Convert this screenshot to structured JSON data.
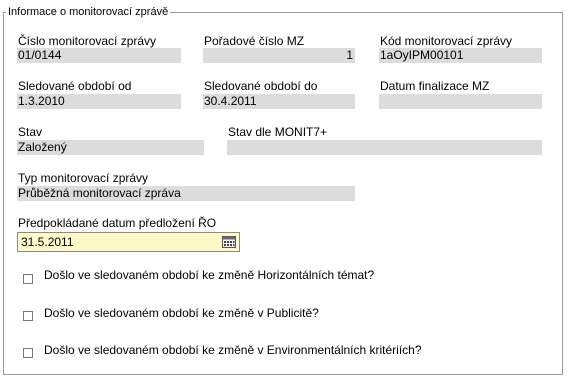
{
  "section": {
    "legend": "Informace o monitorovací zprávě"
  },
  "fields": {
    "cislo_mz": {
      "label": "Číslo monitorovací zprávy",
      "value": "01/0144"
    },
    "poradove_cislo": {
      "label": "Pořadové číslo MZ",
      "value": "1"
    },
    "kod_mz": {
      "label": "Kód monitorovací zprávy",
      "value": "1aOyIPM00101"
    },
    "obdobi_od": {
      "label": "Sledované období od",
      "value": "1.3.2010"
    },
    "obdobi_do": {
      "label": "Sledované období do",
      "value": "30.4.2011"
    },
    "datum_finalizace": {
      "label": "Datum finalizace MZ",
      "value": ""
    },
    "stav": {
      "label": "Stav",
      "value": "Založený"
    },
    "stav_monit": {
      "label": "Stav dle MONIT7+",
      "value": ""
    },
    "typ_mz": {
      "label": "Typ monitorovací zprávy",
      "value": "Průběžná monitorovací zpráva"
    },
    "predpokladane_datum": {
      "label": "Předpokládané datum předložení ŘO",
      "value": "31.5.2011"
    }
  },
  "checkboxes": [
    {
      "label": "Došlo ve sledovaném období ke změně Horizontálních témat?",
      "checked": false
    },
    {
      "label": "Došlo ve sledovaném období ke změně v Publicitě?",
      "checked": false
    },
    {
      "label": "Došlo ve sledovaném období ke změně v Environmentálních kritériích?",
      "checked": false
    }
  ],
  "icons": {
    "date_picker": "calendar-icon"
  },
  "colors": {
    "readonly_bg": "#dcdcdc",
    "date_input_bg": "#fff8c8"
  }
}
